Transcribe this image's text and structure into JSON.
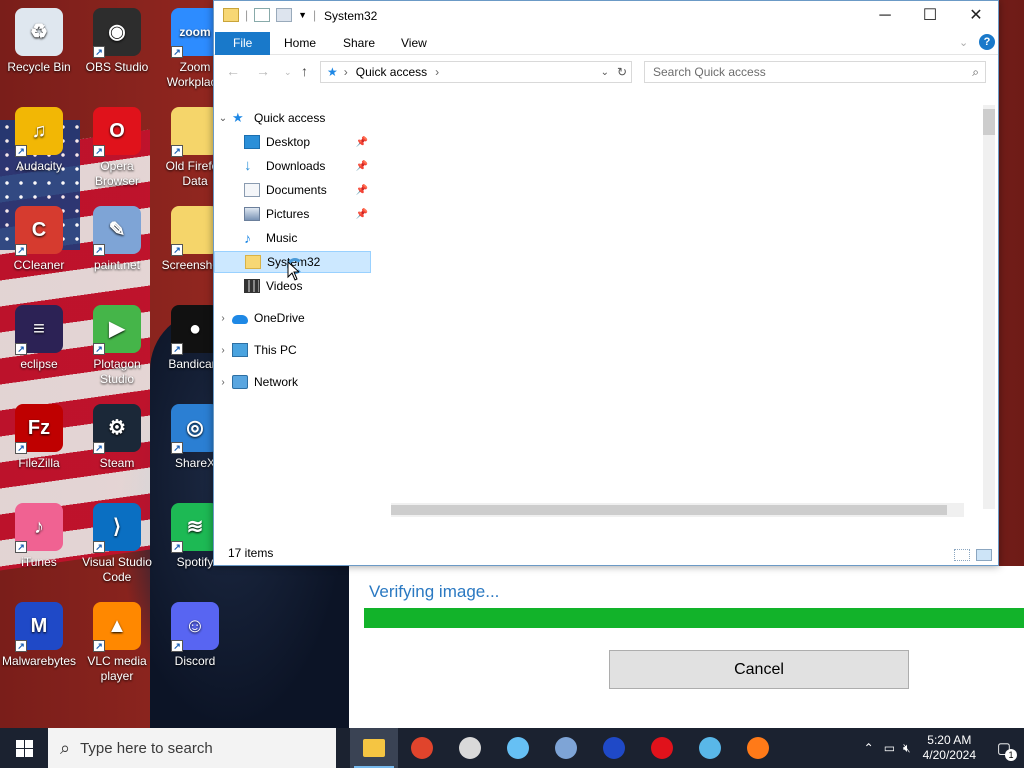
{
  "desktop": {
    "icons": [
      {
        "label": "Recycle Bin",
        "color": "#dfe7ef",
        "glyph": "♻"
      },
      {
        "label": "OBS Studio",
        "color": "#2d2d2d",
        "glyph": "◉"
      },
      {
        "label": "Zoom Workplace",
        "color": "#2d8cff",
        "glyph": "zoom"
      },
      {
        "label": "Audacity",
        "color": "#f2b705",
        "glyph": "♫"
      },
      {
        "label": "Opera Browser",
        "color": "#e0121b",
        "glyph": "O"
      },
      {
        "label": "Old Firefox Data",
        "color": "#f5d56a",
        "glyph": ""
      },
      {
        "label": "CCleaner",
        "color": "#d63b2f",
        "glyph": "C"
      },
      {
        "label": "paint.net",
        "color": "#7ea4d6",
        "glyph": "✎"
      },
      {
        "label": "Screenshots",
        "color": "#f5d56a",
        "glyph": ""
      },
      {
        "label": "eclipse",
        "color": "#2c2255",
        "glyph": "≡"
      },
      {
        "label": "Plotagon Studio",
        "color": "#45b549",
        "glyph": "▶"
      },
      {
        "label": "Bandicam",
        "color": "#111111",
        "glyph": "●"
      },
      {
        "label": "FileZilla",
        "color": "#bf0000",
        "glyph": "Fz"
      },
      {
        "label": "Steam",
        "color": "#1b2838",
        "glyph": "⚙"
      },
      {
        "label": "ShareX",
        "color": "#2b7fd3",
        "glyph": "◎"
      },
      {
        "label": "iTunes",
        "color": "#f06292",
        "glyph": "♪"
      },
      {
        "label": "Visual Studio Code",
        "color": "#0a6fc2",
        "glyph": "⟩"
      },
      {
        "label": "Spotify",
        "color": "#1db954",
        "glyph": "≋"
      },
      {
        "label": "Malwarebytes",
        "color": "#1f49c7",
        "glyph": "M"
      },
      {
        "label": "VLC media player",
        "color": "#ff8800",
        "glyph": "▲"
      },
      {
        "label": "Discord",
        "color": "#5865f2",
        "glyph": "☺"
      }
    ]
  },
  "installer": {
    "status_text": "Verifying image...",
    "progress": 1.0,
    "progress_color": "#12b32a",
    "cancel_label": "Cancel"
  },
  "explorer": {
    "title": "System32",
    "window_controls": {
      "minimize": "─",
      "maximize": "☐",
      "close": "✕"
    },
    "ribbon_tabs": [
      "File",
      "Home",
      "Share",
      "View"
    ],
    "address": {
      "location": "Quick access"
    },
    "search_placeholder": "Search Quick access",
    "nav": {
      "quick_access": "Quick access",
      "pinned": [
        {
          "label": "Desktop",
          "pinned": true,
          "icon": "desktop-icon"
        },
        {
          "label": "Downloads",
          "pinned": true,
          "icon": "downloads-icon"
        },
        {
          "label": "Documents",
          "pinned": true,
          "icon": "documents-icon"
        },
        {
          "label": "Pictures",
          "pinned": true,
          "icon": "pictures-icon"
        },
        {
          "label": "Music",
          "pinned": false,
          "icon": "music-icon"
        },
        {
          "label": "System32",
          "pinned": false,
          "icon": "folder-icon",
          "selected": true
        },
        {
          "label": "Videos",
          "pinned": false,
          "icon": "videos-icon"
        }
      ],
      "roots": [
        "OneDrive",
        "This PC",
        "Network"
      ]
    },
    "status": "17 items"
  },
  "taskbar": {
    "search_placeholder": "Type here to search",
    "apps": [
      {
        "name": "file-explorer",
        "color": "#f5c542",
        "active": true
      },
      {
        "name": "chrome",
        "color": "#e0442c"
      },
      {
        "name": "obs",
        "color": "#d9d9d9"
      },
      {
        "name": "steam",
        "color": "#66c0f4"
      },
      {
        "name": "paint-net",
        "color": "#7ea4d6"
      },
      {
        "name": "malwarebytes",
        "color": "#1f49c7"
      },
      {
        "name": "opera",
        "color": "#e0121b"
      },
      {
        "name": "notepad",
        "color": "#59b7e8"
      },
      {
        "name": "firefox",
        "color": "#ff7a18"
      }
    ],
    "clock_time": "5:20 AM",
    "clock_date": "4/20/2024",
    "notification_count": "1"
  }
}
